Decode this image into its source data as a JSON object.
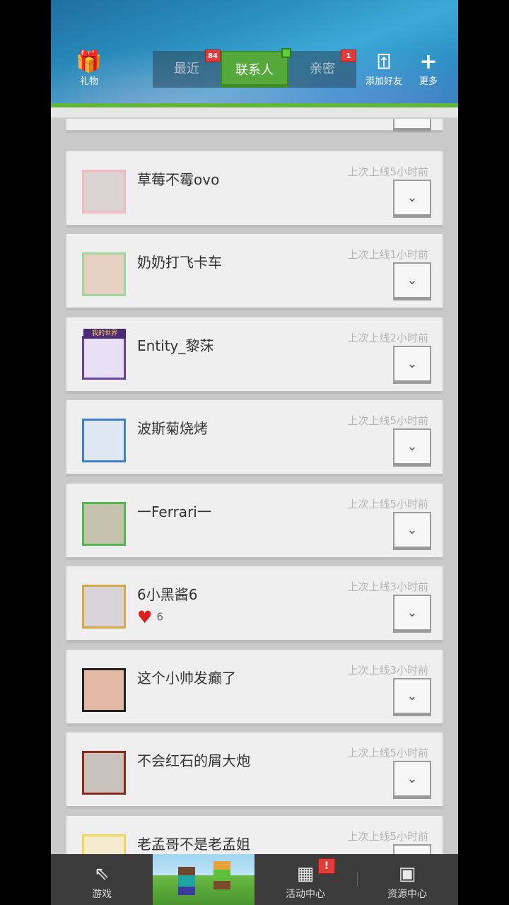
{
  "header": {
    "gift_label": "礼物",
    "tabs": [
      {
        "label": "最近",
        "badge": "84"
      },
      {
        "label": "联系人",
        "active": true
      },
      {
        "label": "亲密",
        "badge": "1"
      }
    ],
    "add_friend_label": "添加好友",
    "more_label": "更多"
  },
  "contacts": [
    {
      "name": "草莓不霉ovo",
      "last_online": "上次上线5小时前"
    },
    {
      "name": "奶奶打飞卡车",
      "last_online": "上次上线1小时前"
    },
    {
      "name": "Entity_黎莯",
      "last_online": "上次上线2小时前"
    },
    {
      "name": "波斯菊烧烤",
      "last_online": "上次上线5小时前"
    },
    {
      "name": "一Ferrari一",
      "last_online": "上次上线5小时前"
    },
    {
      "name": "6小黑酱6",
      "last_online": "上次上线3小时前",
      "likes": "6"
    },
    {
      "name": "这个小帅发癫了",
      "last_online": "上次上线3小时前"
    },
    {
      "name": "不会红石的屑大炮",
      "last_online": "上次上线5小时前"
    },
    {
      "name": "老孟哥不是老孟姐",
      "last_online": "上次上线5小时前"
    }
  ],
  "avatar_frame_text": "我的世界",
  "bottom_nav": {
    "games": "游戏",
    "events": "活动中心",
    "events_badge": "!",
    "resources": "资源中心"
  }
}
